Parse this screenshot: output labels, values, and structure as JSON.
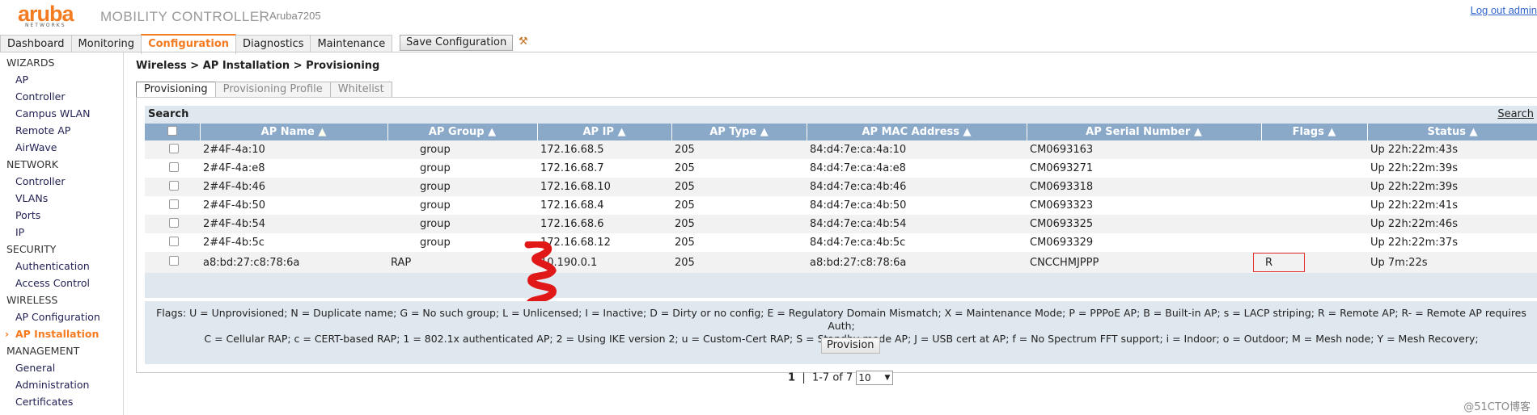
{
  "header": {
    "logo_word": "aruba",
    "logo_sub": "NETWORKS",
    "product": "MOBILITY CONTROLLER",
    "separator": "|",
    "model": "Aruba7205",
    "logout": "Log out admin"
  },
  "nav_tabs": [
    "Dashboard",
    "Monitoring",
    "Configuration",
    "Diagnostics",
    "Maintenance"
  ],
  "save_button": "Save Configuration",
  "sidebar": {
    "sections": [
      {
        "title": "WIZARDS",
        "items": [
          "AP",
          "Controller",
          "Campus WLAN",
          "Remote AP",
          "AirWave"
        ]
      },
      {
        "title": "NETWORK",
        "items": [
          "Controller",
          "VLANs",
          "Ports",
          "IP"
        ]
      },
      {
        "title": "SECURITY",
        "items": [
          "Authentication",
          "Access Control"
        ]
      },
      {
        "title": "WIRELESS",
        "items": [
          "AP Configuration",
          "AP Installation"
        ]
      },
      {
        "title": "MANAGEMENT",
        "items": [
          "General",
          "Administration",
          "Certificates"
        ]
      }
    ],
    "active": "AP Installation"
  },
  "breadcrumb": "Wireless > AP Installation > Provisioning",
  "subtabs": [
    "Provisioning",
    "Provisioning Profile",
    "Whitelist"
  ],
  "search": {
    "title": "Search",
    "link": "Search"
  },
  "table": {
    "columns": [
      "AP Name",
      "AP Group",
      "AP IP",
      "AP Type",
      "AP MAC Address",
      "AP Serial Number",
      "Flags",
      "Status"
    ],
    "sort_arrows": [
      "▲",
      "▲",
      "▲",
      "▲",
      "▲",
      "▲",
      "▲",
      "▲"
    ],
    "rows": [
      {
        "name": "2#4F-4a:10",
        "group": "group",
        "ip": "172.16.68.5",
        "type": "205",
        "mac": "84:d4:7e:ca:4a:10",
        "serial": "CM0693163",
        "flags": "",
        "status": "Up 22h:22m:43s"
      },
      {
        "name": "2#4F-4a:e8",
        "group": "group",
        "ip": "172.16.68.7",
        "type": "205",
        "mac": "84:d4:7e:ca:4a:e8",
        "serial": "CM0693271",
        "flags": "",
        "status": "Up 22h:22m:39s"
      },
      {
        "name": "2#4F-4b:46",
        "group": "group",
        "ip": "172.16.68.10",
        "type": "205",
        "mac": "84:d4:7e:ca:4b:46",
        "serial": "CM0693318",
        "flags": "",
        "status": "Up 22h:22m:39s"
      },
      {
        "name": "2#4F-4b:50",
        "group": "group",
        "ip": "172.16.68.4",
        "type": "205",
        "mac": "84:d4:7e:ca:4b:50",
        "serial": "CM0693323",
        "flags": "",
        "status": "Up 22h:22m:41s"
      },
      {
        "name": "2#4F-4b:54",
        "group": "group",
        "ip": "172.16.68.6",
        "type": "205",
        "mac": "84:d4:7e:ca:4b:54",
        "serial": "CM0693325",
        "flags": "",
        "status": "Up 22h:22m:46s"
      },
      {
        "name": "2#4F-4b:5c",
        "group": "group",
        "ip": "172.16.68.12",
        "type": "205",
        "mac": "84:d4:7e:ca:4b:5c",
        "serial": "CM0693329",
        "flags": "",
        "status": "Up 22h:22m:37s"
      },
      {
        "name": "a8:bd:27:c8:78:6a",
        "group": "RAP",
        "ip": "10.190.0.1",
        "type": "205",
        "mac": "a8:bd:27:c8:78:6a",
        "serial": "CNCCHMJPPP",
        "flags": "R",
        "status": "Up 7m:22s"
      }
    ]
  },
  "pager": {
    "current": "1",
    "sep": "|",
    "range": "1-7 of 7",
    "page_size": "10"
  },
  "flags_legend": {
    "line1": "Flags: U = Unprovisioned; N = Duplicate name; G = No such group; L = Unlicensed; I = Inactive; D = Dirty or no config; E = Regulatory Domain Mismatch; X = Maintenance Mode; P = PPPoE AP; B = Built-in AP; s = LACP striping; R = Remote AP; R- = Remote AP requires Auth;",
    "line2": "C = Cellular RAP; c = CERT-based RAP; 1 = 802.1x authenticated AP; 2 = Using IKE version 2; u = Custom-Cert RAP; S = Standby-mode AP; J = USB cert at AP; f = No Spectrum FFT support; i = Indoor; o = Outdoor; M = Mesh node; Y = Mesh Recovery;"
  },
  "provision_button": "Provision",
  "watermark": "@51CTO博客",
  "colors": {
    "accent": "#f47b20",
    "header_bg": "#8aa8c8",
    "panel_bg": "#dfe7ef",
    "highlight": "#e03030"
  },
  "icons": {
    "pin": "pin-icon",
    "checkbox": "checkbox"
  }
}
